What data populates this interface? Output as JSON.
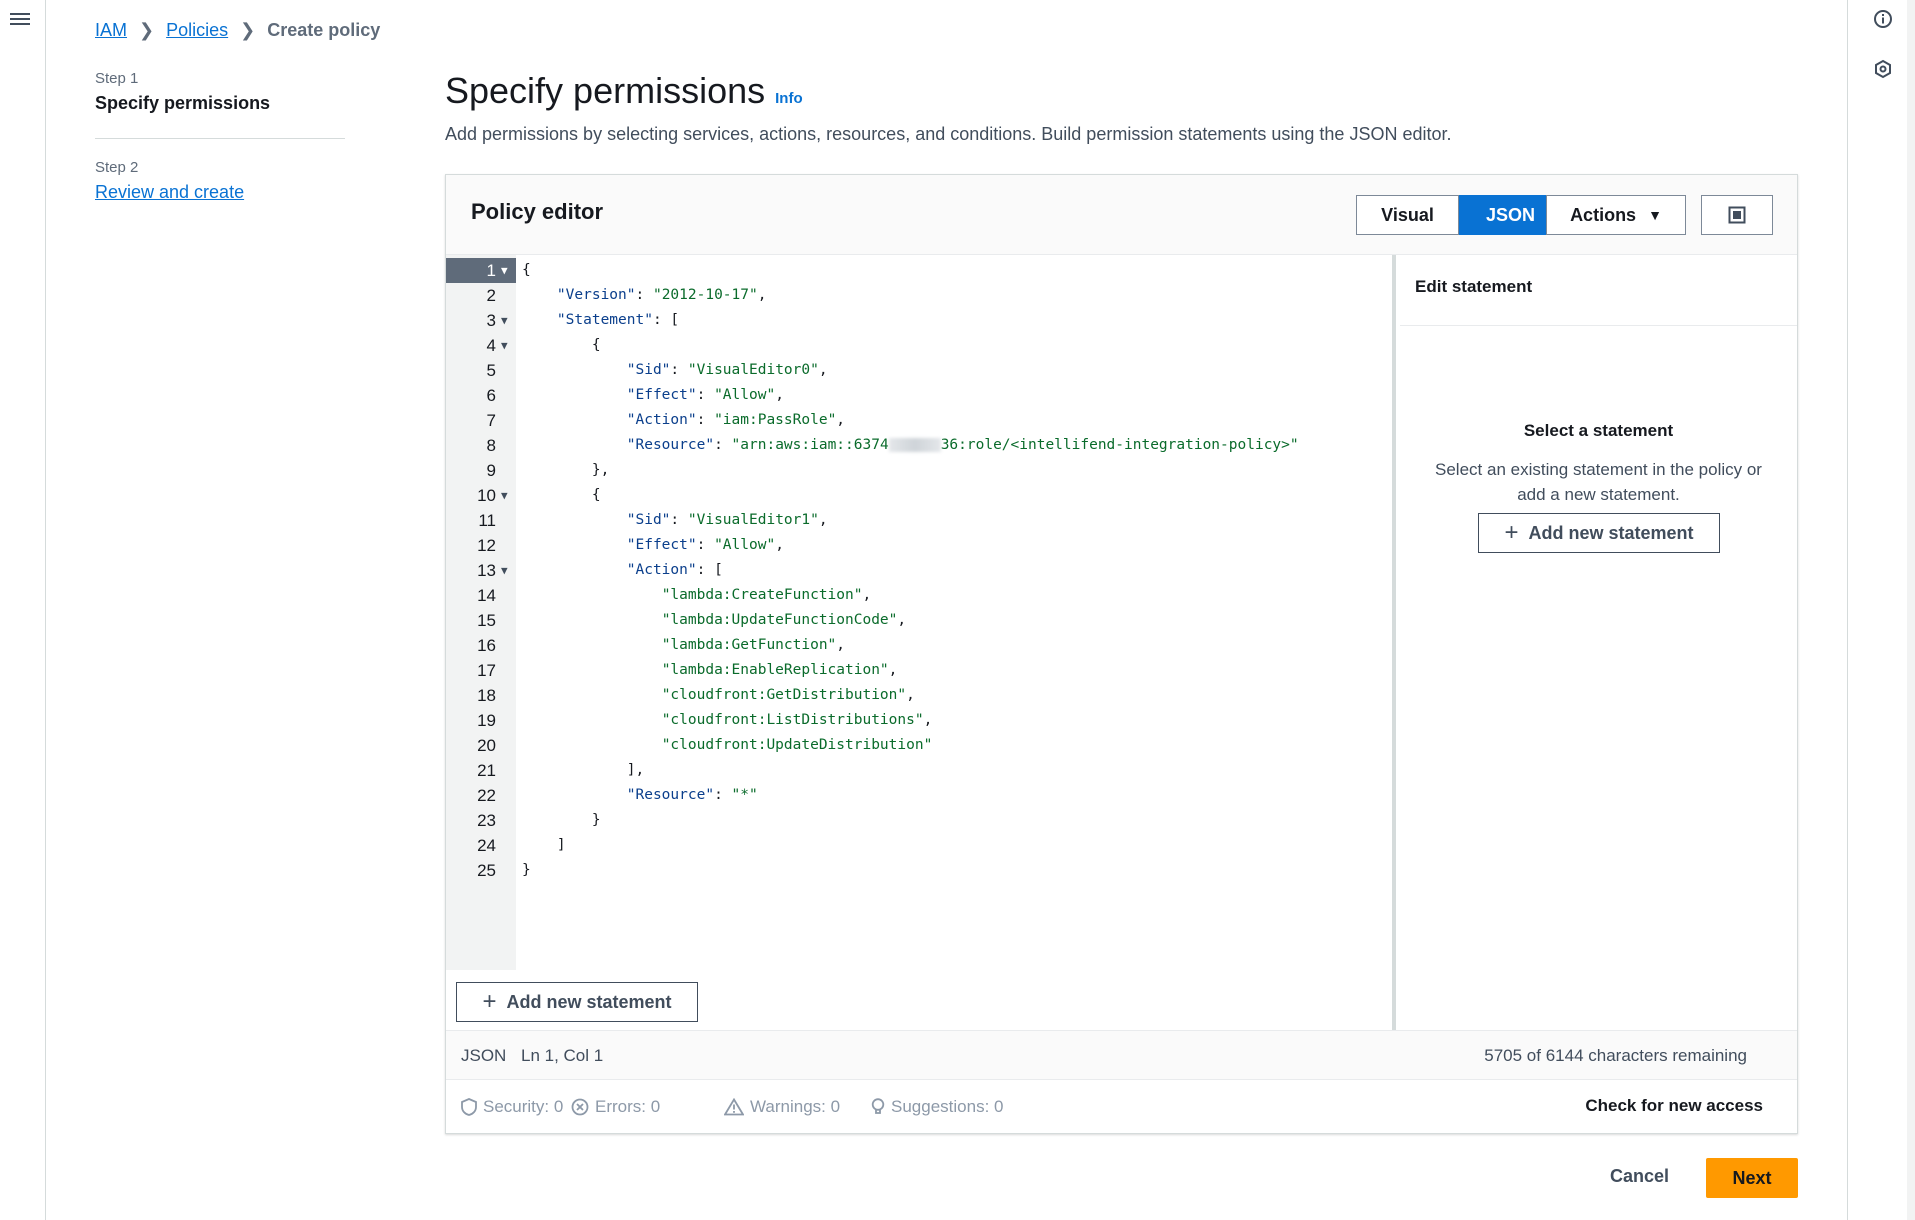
{
  "breadcrumb": {
    "root": "IAM",
    "section": "Policies",
    "current": "Create policy"
  },
  "steps": [
    {
      "label": "Step 1",
      "title": "Specify permissions"
    },
    {
      "label": "Step 2",
      "title": "Review and create"
    }
  ],
  "header": {
    "title": "Specify permissions",
    "info": "Info",
    "description": "Add permissions by selecting services, actions, resources, and conditions. Build permission statements using the JSON editor."
  },
  "editor": {
    "title": "Policy editor",
    "modes": [
      "Visual",
      "JSON"
    ],
    "active_mode": "JSON",
    "actions_label": "Actions",
    "add_statement_label": "Add new statement",
    "code": {
      "l1": "{",
      "l2k": "\"Version\"",
      "l2v": "\"2012-10-17\"",
      "l3k": "\"Statement\"",
      "l5k": "\"Sid\"",
      "l5v": "\"VisualEditor0\"",
      "l6k": "\"Effect\"",
      "l6v": "\"Allow\"",
      "l7k": "\"Action\"",
      "l7v": "\"iam:PassRole\"",
      "l8k": "\"Resource\"",
      "l8v_a": "\"arn:aws:iam::6374",
      "l8v_b": "36:role/<intellifend-integration-policy>\"",
      "l11k": "\"Sid\"",
      "l11v": "\"VisualEditor1\"",
      "l12k": "\"Effect\"",
      "l12v": "\"Allow\"",
      "l13k": "\"Action\"",
      "l14": "\"lambda:CreateFunction\"",
      "l15": "\"lambda:UpdateFunctionCode\"",
      "l16": "\"lambda:GetFunction\"",
      "l17": "\"lambda:EnableReplication\"",
      "l18": "\"cloudfront:GetDistribution\"",
      "l19": "\"cloudfront:ListDistributions\"",
      "l20": "\"cloudfront:UpdateDistribution\"",
      "l22k": "\"Resource\"",
      "l22v": "\"*\""
    }
  },
  "side_panel": {
    "title": "Edit statement",
    "empty_title": "Select a statement",
    "empty_desc": "Select an existing statement in the policy or add a new statement.",
    "add_label": "Add new statement"
  },
  "status": {
    "mode": "JSON",
    "position": "Ln 1, Col 1",
    "chars": "5705 of 6144 characters remaining"
  },
  "validation": {
    "security": "Security: 0",
    "errors": "Errors: 0",
    "warnings": "Warnings: 0",
    "suggestions": "Suggestions: 0",
    "check_access": "Check for new access"
  },
  "footer": {
    "cancel": "Cancel",
    "next": "Next"
  }
}
